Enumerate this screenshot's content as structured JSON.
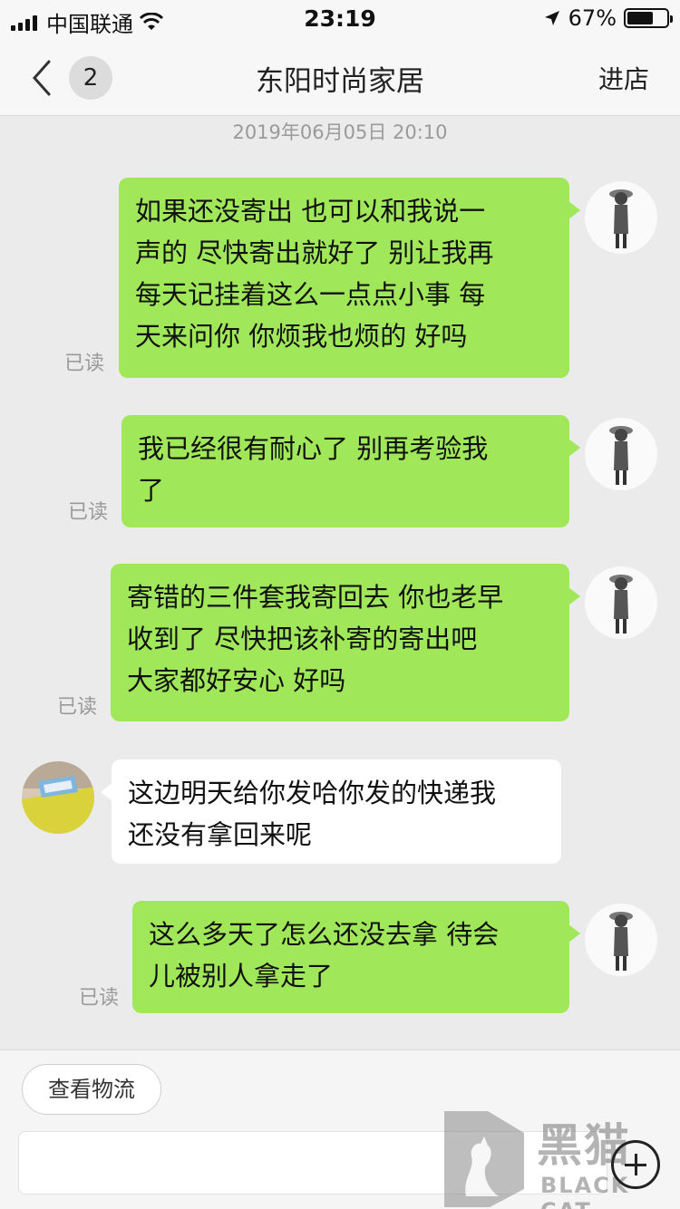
{
  "status_bar": {
    "carrier": "中国联通",
    "time": "23:19",
    "battery": "67%",
    "battery_level": 0.67
  },
  "nav": {
    "back_count": "2",
    "title": "东阳时尚家居",
    "action": "进店"
  },
  "timestamp": "2019年06月05日 20:10",
  "messages": [
    {
      "side": "out",
      "text": "如果还没寄出  也可以和我说一\n声的  尽快寄出就好了  别让我再\n每天记挂着这么一点点小事  每\n天来问你  你烦我也烦的  好吗",
      "status": "已读"
    },
    {
      "side": "out",
      "text": "我已经很有耐心了   别再考验我\n了",
      "status": "已读"
    },
    {
      "side": "out",
      "text": "寄错的三件套我寄回去 你也老早\n收到了  尽快把该补寄的寄出吧\n大家都好安心  好吗",
      "status": "已读"
    },
    {
      "side": "in",
      "text": "这边明天给你发哈你发的快递我\n还没有拿回来呢"
    },
    {
      "side": "out",
      "text": "这么多天了怎么还没去拿  待会\n儿被别人拿走了",
      "status": "已读"
    }
  ],
  "bottom": {
    "logistics_label": "查看物流",
    "input_placeholder": ""
  },
  "watermark": {
    "cn": "黑猫",
    "en": "BLACK CAT"
  },
  "icons": [
    "signal-icon",
    "wifi-icon",
    "location-arrow-icon",
    "battery-icon",
    "back-chevron-icon",
    "plus-icon",
    "black-cat-logo-icon"
  ]
}
